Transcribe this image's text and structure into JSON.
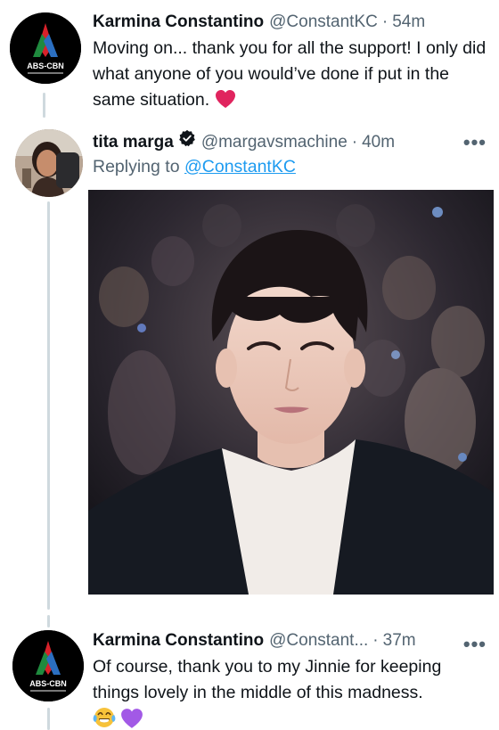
{
  "tweets": [
    {
      "author": "Karmina Constantino",
      "handle": "@ConstantKC",
      "sep": "·",
      "time": "54m",
      "text": "Moving on... thank you for all the support! I only did what anyone of you would’ve done if put in the same situation.",
      "emoji": "heart"
    },
    {
      "author": "tita marga",
      "handle": "@margavsmachine",
      "sep": "·",
      "time": "40m",
      "replying_prefix": "Replying to ",
      "replying_to": "@ConstantKC",
      "more": "•••",
      "verified": true,
      "media": "photo-portrait"
    },
    {
      "author": "Karmina Constantino",
      "handle": "@Constant...",
      "sep": "·",
      "time": "37m",
      "more": "•••",
      "text": "Of course, thank you to my Jinnie for keeping things lovely in the middle of this madness.",
      "emojis": [
        "face-with-tears-of-joy",
        "purple-heart"
      ]
    }
  ],
  "avatar_logo_text": "ABS-CBN",
  "colors": {
    "text": "#0f1419",
    "secondary": "#536471",
    "link": "#1d9bf0",
    "thread_line": "#cfd9de",
    "heart": "#e0245e",
    "purple_heart": "#a259e6"
  }
}
